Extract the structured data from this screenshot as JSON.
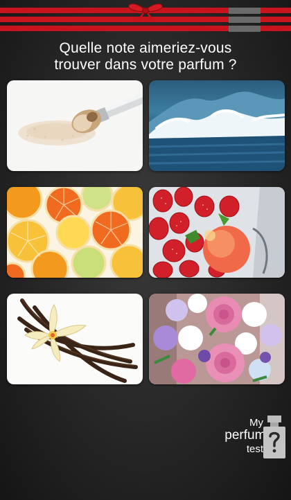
{
  "header": {
    "menu_icon": "hamburger-menu-icon",
    "bow_icon": "red-bow-icon",
    "accent_color": "#c8141c"
  },
  "question": {
    "line1": "Quelle note aimeriez-vous",
    "line2": "trouver dans votre parfum ?"
  },
  "tiles": [
    {
      "image": "face powder with makeup brush"
    },
    {
      "image": "ocean wave"
    },
    {
      "image": "citrus slices"
    },
    {
      "image": "strawberries and peach"
    },
    {
      "image": "vanilla flower and pods"
    },
    {
      "image": "rose and flower bouquet"
    }
  ],
  "logo": {
    "line1": "My",
    "line2": "perfume",
    "line3": "test",
    "icon": "perfume-bottle-question-icon"
  }
}
